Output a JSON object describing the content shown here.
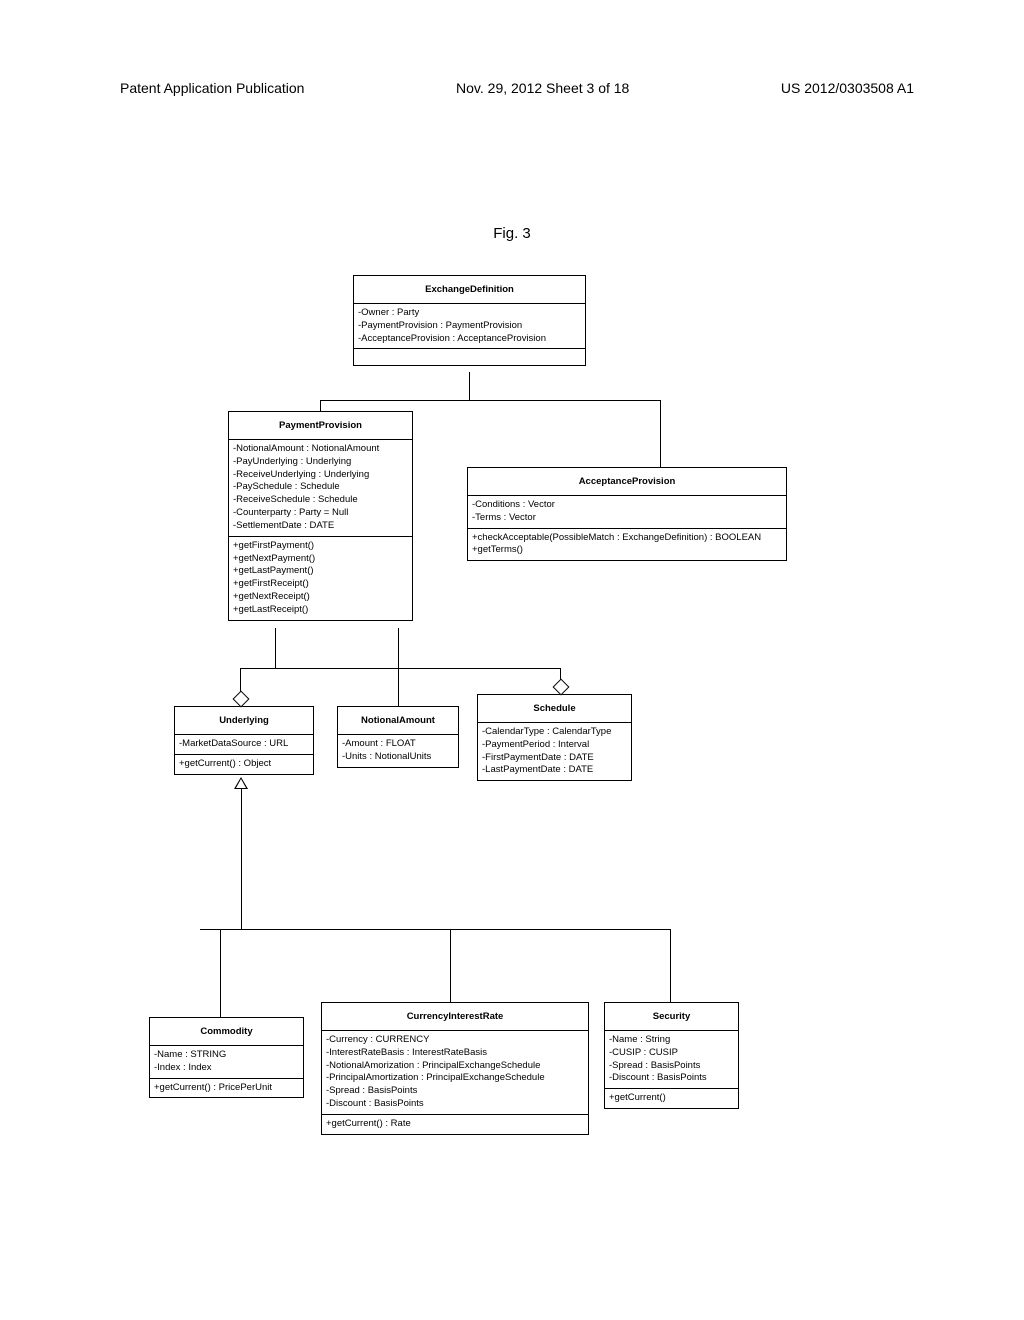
{
  "header": {
    "left": "Patent Application Publication",
    "center": "Nov. 29, 2012   Sheet 3 of 18",
    "right": "US 2012/0303508 A1"
  },
  "figure_label": "Fig. 3",
  "classes": {
    "ExchangeDefinition": {
      "title": "ExchangeDefinition",
      "attrs": [
        "-Owner : Party",
        "-PaymentProvision : PaymentProvision",
        "-AcceptanceProvision : AcceptanceProvision"
      ]
    },
    "PaymentProvision": {
      "title": "PaymentProvision",
      "attrs": [
        "-NotionalAmount : NotionalAmount",
        "-PayUnderlying : Underlying",
        "-ReceiveUnderlying : Underlying",
        "-PaySchedule : Schedule",
        "-ReceiveSchedule : Schedule",
        "-Counterparty : Party = Null",
        "-SettlementDate : DATE"
      ],
      "ops": [
        "+getFirstPayment()",
        "+getNextPayment()",
        "+getLastPayment()",
        "+getFirstReceipt()",
        "+getNextReceipt()",
        "+getLastReceipt()"
      ]
    },
    "AcceptanceProvision": {
      "title": "AcceptanceProvision",
      "attrs": [
        "-Conditions : Vector",
        "-Terms : Vector"
      ],
      "ops": [
        "+checkAcceptable(PossibleMatch : ExchangeDefinition) : BOOLEAN",
        "+getTerms()"
      ]
    },
    "Underlying": {
      "title": "Underlying",
      "attrs": [
        "-MarketDataSource : URL"
      ],
      "ops": [
        "+getCurrent() : Object"
      ]
    },
    "NotionalAmount": {
      "title": "NotionalAmount",
      "attrs": [
        "-Amount : FLOAT",
        "-Units : NotionalUnits"
      ]
    },
    "Schedule": {
      "title": "Schedule",
      "attrs": [
        "-CalendarType : CalendarType",
        "-PaymentPeriod : Interval",
        "-FirstPaymentDate : DATE",
        "-LastPaymentDate : DATE"
      ]
    },
    "Commodity": {
      "title": "Commodity",
      "attrs": [
        "-Name : STRING",
        "-Index : Index"
      ],
      "ops": [
        "+getCurrent() : PricePerUnit"
      ]
    },
    "CurrencyInterestRate": {
      "title": "CurrencyInterestRate",
      "attrs": [
        "-Currency : CURRENCY",
        "-InterestRateBasis : InterestRateBasis",
        "-NotionalAmorization : PrincipalExchangeSchedule",
        "-PrincipalAmortization : PrincipalExchangeSchedule",
        "-Spread : BasisPoints",
        "-Discount : BasisPoints"
      ],
      "ops": [
        "+getCurrent() : Rate"
      ]
    },
    "Security": {
      "title": "Security",
      "attrs": [
        "-Name : String",
        "-CUSIP : CUSIP",
        "-Spread : BasisPoints",
        "-Discount : BasisPoints"
      ],
      "ops": [
        "+getCurrent()"
      ]
    }
  }
}
